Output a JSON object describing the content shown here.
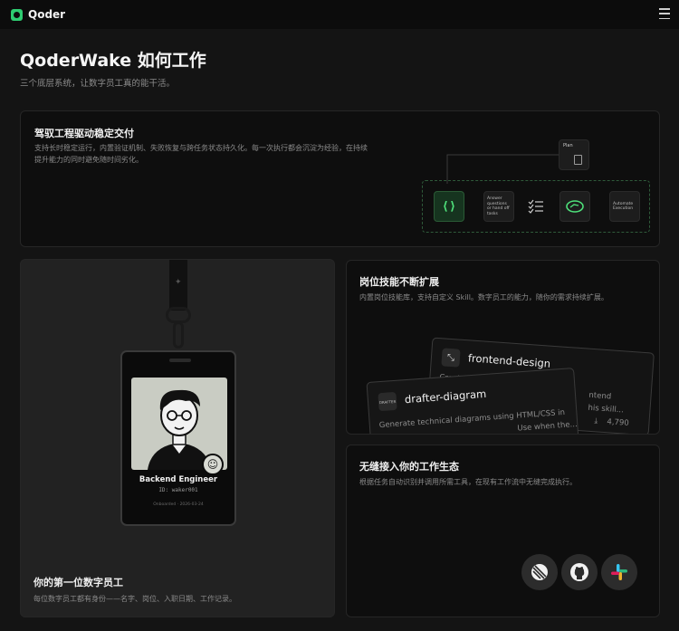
{
  "topbar": {
    "logo_text": "Qoder",
    "logo_icon": "qoder-logo-icon",
    "menu_icon": "hamburger-menu-icon"
  },
  "hero": {
    "title": "QoderWake 如何工作",
    "subtitle": "三个底层系统，让数字员工真的能干活。"
  },
  "cards": {
    "engineering": {
      "title": "驾驭工程驱动稳定交付",
      "desc_line1": "支持长时稳定运行，内置验证机制、失败恢复与跨任务状态持久化。每一次执行都会沉淀为经验，在持续",
      "desc_line2": "提升能力的同时避免随时间劣化。",
      "plan_label": "Plan",
      "node_code": "⟨⟩",
      "node_answer": "Answer questions or hand off tasks",
      "node_execution": "Automate Execution"
    },
    "badge": {
      "name": "Backend Engineer",
      "id": "ID: waker001",
      "date": "Onboarded · 2026-03-24",
      "title": "你的第一位数字员工",
      "desc": "每位数字员工都有身份——名字、岗位、入职日期、工作记录。"
    },
    "skills": {
      "title": "岗位技能不断扩展",
      "desc": "内置岗位技能库，支持自定义 Skill。数字员工的能力，随你的需求持续扩展。",
      "skill_a_name": "frontend-design",
      "skill_a_desc1": "Create distinc",
      "skill_a_desc2": "ntend",
      "skill_a_desc3": "his skill...",
      "skill_a_count": "4,790",
      "skill_b_name": "drafter-diagram",
      "skill_b_icon_text": "DRAFTER",
      "skill_b_desc1": "Generate technical diagrams using HTML/CSS in",
      "skill_b_desc2": "Use when the..."
    },
    "ecosystem": {
      "title": "无缝接入你的工作生态",
      "desc": "根据任务自动识别并调用所需工具，在现有工作流中无缝完成执行。"
    }
  },
  "colors": {
    "accent": "#2ecc71",
    "background": "#141414",
    "card": "#0e0e0e"
  }
}
